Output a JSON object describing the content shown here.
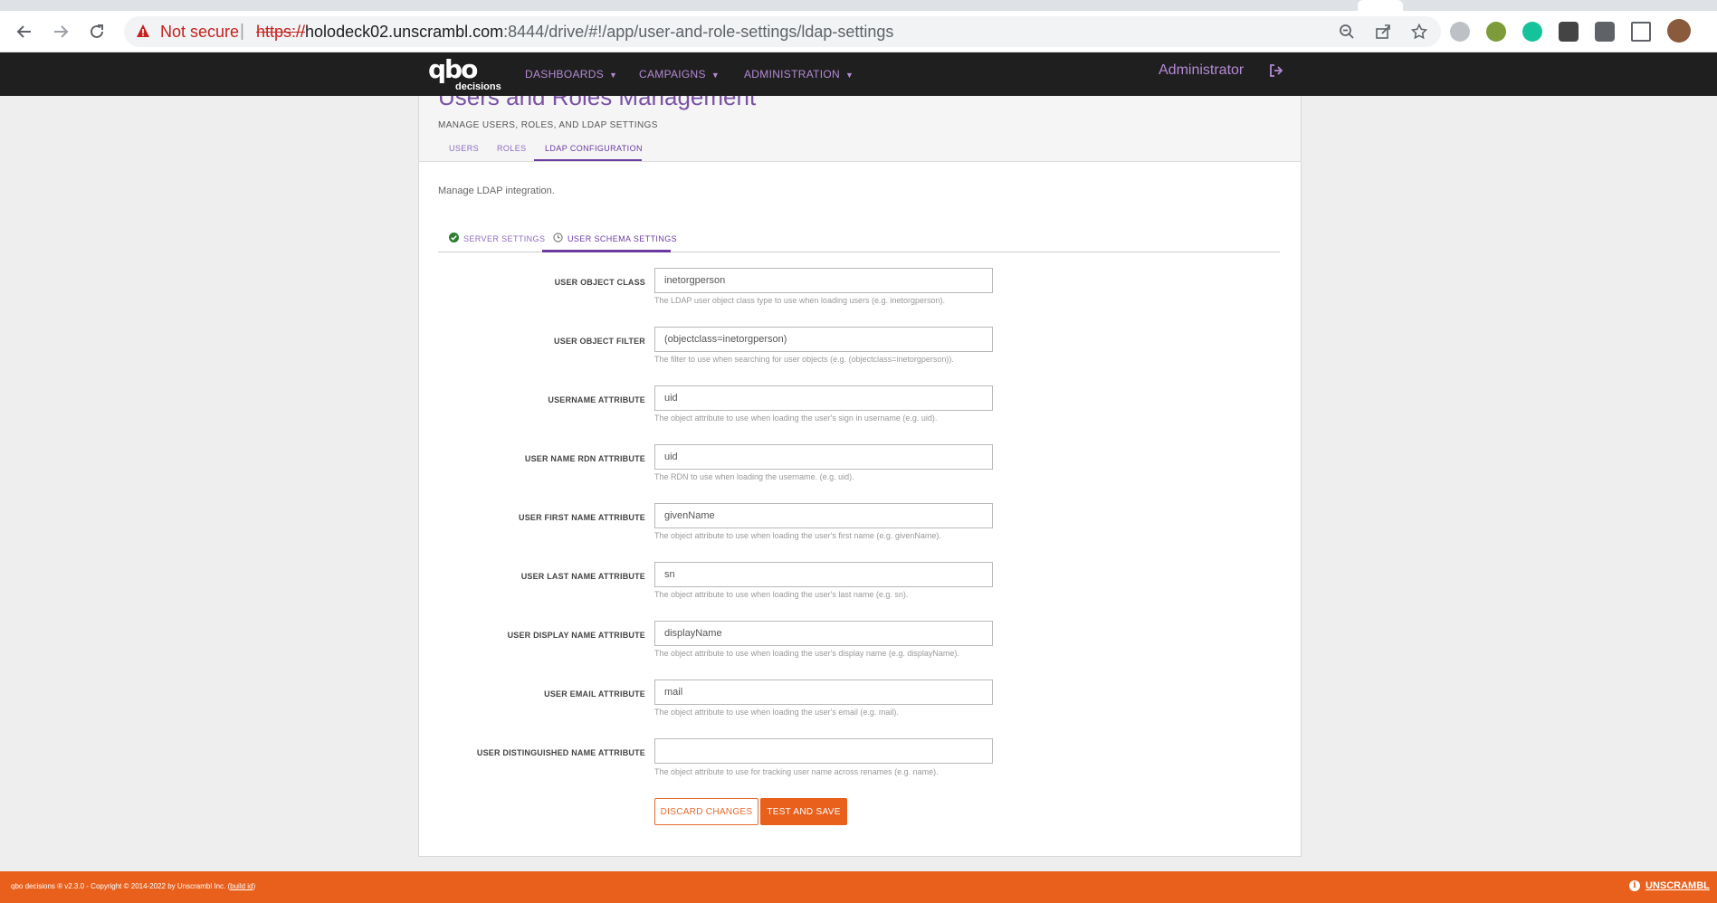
{
  "browser": {
    "security_label": "Not secure",
    "url_scheme": "https://",
    "url_host": "holodeck02.unscrambl.com",
    "url_path": ":8444/drive/#!/app/user-and-role-settings/ldap-settings",
    "nav_icons": [
      "back-arrow-icon",
      "forward-arrow-icon",
      "reload-icon"
    ],
    "omnibox_icons": [
      "zoom-out-icon",
      "share-icon",
      "bookmark-star-icon"
    ],
    "extension_colors": [
      "#9aa0a6",
      "#6b8e23",
      "#15c39a",
      "#444444",
      "#5f6368",
      "#5f6368",
      "#8a5a3c"
    ]
  },
  "header": {
    "logo_mark": "qbo",
    "logo_sub": "decisions",
    "menu": [
      {
        "label": "DASHBOARDS"
      },
      {
        "label": "CAMPAIGNS"
      },
      {
        "label": "ADMINISTRATION"
      }
    ],
    "user": "Administrator",
    "signout_icon": "sign-out-icon"
  },
  "page": {
    "title": "Users and Roles Management",
    "subtitle": "MANAGE USERS, ROLES, AND LDAP SETTINGS",
    "tabs": [
      {
        "label": "USERS"
      },
      {
        "label": "ROLES"
      },
      {
        "label": "LDAP CONFIGURATION",
        "active": true
      }
    ],
    "intro": "Manage LDAP integration.",
    "subtabs": [
      {
        "label": "SERVER SETTINGS",
        "icon": "check-circle-icon",
        "status_color": "#2e7d32"
      },
      {
        "label": "USER SCHEMA SETTINGS",
        "icon": "clock-circle-icon",
        "active": true
      }
    ]
  },
  "form": {
    "fields": [
      {
        "label": "USER OBJECT CLASS",
        "value": "inetorgperson",
        "help": "The LDAP user object class type to use when loading users (e.g. inetorgperson)."
      },
      {
        "label": "USER OBJECT FILTER",
        "value": "(objectclass=inetorgperson)",
        "help": "The filter to use when searching for user objects (e.g. (objectclass=inetorgperson))."
      },
      {
        "label": "USERNAME ATTRIBUTE",
        "value": "uid",
        "help": "The object attribute to use when loading the user's sign in username (e.g. uid)."
      },
      {
        "label": "USER NAME RDN ATTRIBUTE",
        "value": "uid",
        "help": "The RDN to use when loading the username. (e.g. uid)."
      },
      {
        "label": "USER FIRST NAME ATTRIBUTE",
        "value": "givenName",
        "help": "The object attribute to use when loading the user's first name (e.g. givenName)."
      },
      {
        "label": "USER LAST NAME ATTRIBUTE",
        "value": "sn",
        "help": "The object attribute to use when loading the user's last name (e.g. sn)."
      },
      {
        "label": "USER DISPLAY NAME ATTRIBUTE",
        "value": "displayName",
        "help": "The object attribute to use when loading the user's display name (e.g. displayName)."
      },
      {
        "label": "USER EMAIL ATTRIBUTE",
        "value": "mail",
        "help": "The object attribute to use when loading the user's email (e.g. mail)."
      },
      {
        "label": "USER DISTINGUISHED NAME ATTRIBUTE",
        "value": "",
        "help": "The object attribute to use for tracking user name across renames (e.g. name)."
      }
    ],
    "discard_label": "DISCARD CHANGES",
    "save_label": "TEST AND SAVE"
  },
  "footer": {
    "copyright_prefix": "qbo decisions ® v2.3.0 - Copyright © 2014-2022 by Unscrambl Inc. (",
    "build_link": "build id",
    "copyright_suffix": ")",
    "brand": "UNSCRAMBL",
    "brand_icon": "info-icon"
  },
  "colors": {
    "accent_purple": "#7a52a5",
    "menu_purple": "#b58ad6",
    "orange": "#e8601c",
    "header_bg": "#1f1f1f"
  }
}
